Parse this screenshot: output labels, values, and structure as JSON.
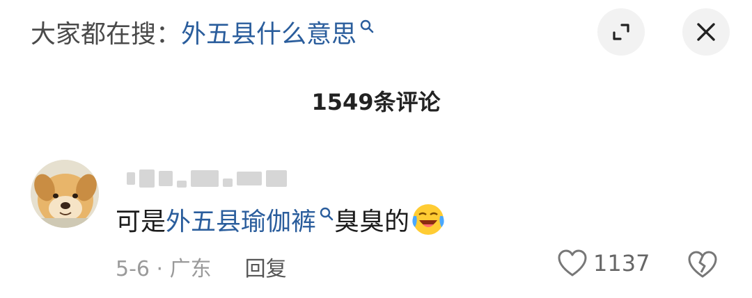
{
  "search_bar": {
    "prefix": "大家都在搜：",
    "term": "外五县什么意思",
    "icon": "search-icon"
  },
  "buttons": {
    "expand_icon": "expand-icon",
    "close_icon": "close-icon"
  },
  "comments_header": {
    "count_label": "1549条评论"
  },
  "comment": {
    "avatar": "dog-avatar",
    "username_blurred": true,
    "text_before": "可是",
    "link_text": "外五县瑜伽裤",
    "text_after": "臭臭的",
    "emoji": "laughing-crying-emoji",
    "date_location": "5-6 · 广东",
    "reply_label": "回复",
    "like_count": "1137"
  },
  "colors": {
    "link": "#2a5d9c",
    "text": "#1b1b1b",
    "muted": "#9a9a9a",
    "button_bg": "#f2f2f2"
  }
}
